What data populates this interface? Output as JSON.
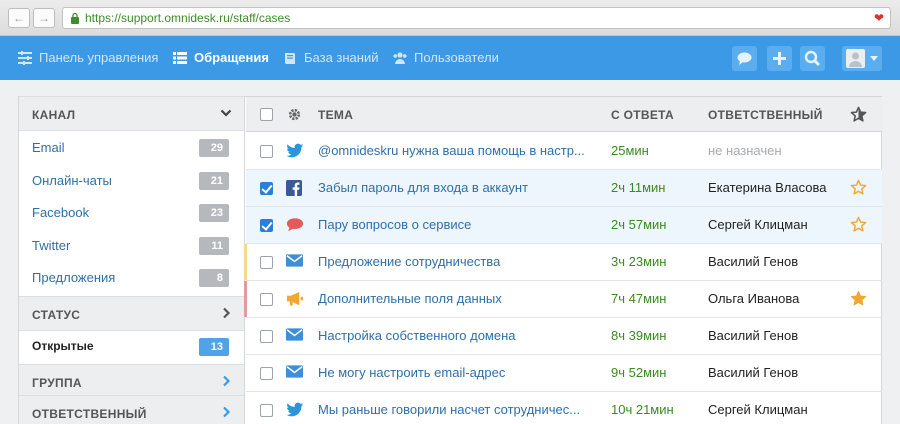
{
  "browser": {
    "url": "https://support.omnidesk.ru/staff/cases",
    "back_icon": "←",
    "forward_icon": "→",
    "heart_icon": "❤"
  },
  "nav": {
    "items": [
      {
        "label": "Панель управления",
        "icon": "dashboard-icon"
      },
      {
        "label": "Обращения",
        "icon": "list-icon",
        "active": true
      },
      {
        "label": "База знаний",
        "icon": "book-icon"
      },
      {
        "label": "Пользователи",
        "icon": "users-icon"
      }
    ],
    "actions": [
      "chat-icon",
      "plus-icon",
      "search-icon",
      "avatar"
    ]
  },
  "sidebar": {
    "channel": {
      "title": "КАНАЛ",
      "items": [
        {
          "label": "Email",
          "count": "29"
        },
        {
          "label": "Онлайн-чаты",
          "count": "21"
        },
        {
          "label": "Facebook",
          "count": "23"
        },
        {
          "label": "Twitter",
          "count": "11"
        },
        {
          "label": "Предложения",
          "count": "8"
        }
      ]
    },
    "status": {
      "title": "СТАТУС",
      "items": [
        {
          "label": "Открытые",
          "count": "13",
          "selected": true
        }
      ]
    },
    "group": {
      "title": "ГРУППА"
    },
    "responsible": {
      "title": "ОТВЕТСТВЕННЫЙ"
    }
  },
  "table": {
    "headers": {
      "subject": "ТЕМА",
      "since_reply": "С ОТВЕТА",
      "responsible": "ОТВЕТСТВЕННЫЙ"
    },
    "rows": [
      {
        "checked": false,
        "channel": "twitter-icon",
        "subject": "@omnideskru нужна ваша помощь в настр...",
        "time": "25мин",
        "owner": "не назначен",
        "unassigned": true,
        "star": "none",
        "mark": ""
      },
      {
        "checked": true,
        "channel": "facebook-icon",
        "subject": "Забыл пароль для входа в аккаунт",
        "time": "2ч 11мин",
        "owner": "Екатерина Власова",
        "star": "outline",
        "mark": ""
      },
      {
        "checked": true,
        "channel": "chat-icon",
        "subject": "Пару вопросов о сервисе",
        "time": "2ч 57мин",
        "owner": "Сергей Клицман",
        "star": "outline",
        "mark": ""
      },
      {
        "checked": false,
        "channel": "email-icon",
        "subject": "Предложение сотрудничества",
        "time": "3ч 23мин",
        "owner": "Василий Генов",
        "star": "none",
        "mark": "#f1dc8a"
      },
      {
        "checked": false,
        "channel": "megaphone-icon",
        "subject": "Дополнительные поля данных",
        "time": "7ч 47мин",
        "owner": "Ольга Иванова",
        "star": "filled",
        "mark": "#e59a9a"
      },
      {
        "checked": false,
        "channel": "email-icon",
        "subject": "Настройка собственного домена",
        "time": "8ч 39мин",
        "owner": "Василий Генов",
        "star": "none",
        "mark": ""
      },
      {
        "checked": false,
        "channel": "email-icon",
        "subject": "Не могу настроить email-адрес",
        "time": "9ч 52мин",
        "owner": "Василий Генов",
        "star": "none",
        "mark": ""
      },
      {
        "checked": false,
        "channel": "twitter-icon",
        "subject": "Мы раньше говорили насчет сотрудничес...",
        "time": "10ч 21мин",
        "owner": "Сергей Клицман",
        "star": "none",
        "mark": ""
      }
    ]
  },
  "colors": {
    "brand": "#3c99e6",
    "star": "#f0a830",
    "twitter": "#2b95d9",
    "facebook": "#3b5998",
    "chat": "#e25a5a",
    "email": "#3d8fd8",
    "megaphone": "#f0a830"
  }
}
